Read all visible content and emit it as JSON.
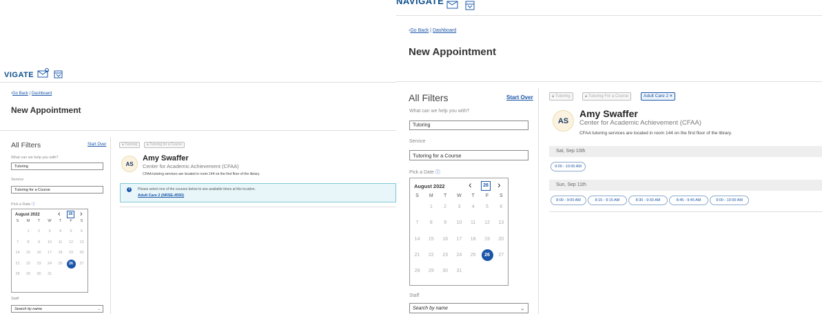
{
  "app": {
    "nav_title": "NAVIGATE",
    "nav_title_left": "VIGATE",
    "breadcrumb": {
      "back": "Go Back",
      "sep": "|",
      "dashboard": "Dashboard"
    },
    "page_title": "New Appointment"
  },
  "filters": {
    "title": "All Filters",
    "start_over": "Start Over",
    "help_label": "What can we help you with?",
    "help_value": "Tutoring",
    "service_label": "Service",
    "service_value": "Tutoring for a Course",
    "date_label": "Pick a Date",
    "staff_label": "Staff",
    "staff_placeholder": "Search by name"
  },
  "calendar": {
    "month": "August 2022",
    "today": "26",
    "selected": "26",
    "dow": [
      "S",
      "M",
      "T",
      "W",
      "T",
      "F",
      "S"
    ],
    "weeks": [
      [
        "",
        "1",
        "2",
        "3",
        "4",
        "5",
        "6"
      ],
      [
        "7",
        "8",
        "9",
        "10",
        "11",
        "12",
        "13"
      ],
      [
        "14",
        "15",
        "16",
        "17",
        "18",
        "19",
        "20"
      ],
      [
        "21",
        "22",
        "23",
        "24",
        "25",
        "26",
        "27"
      ],
      [
        "28",
        "29",
        "30",
        "31",
        "",
        "",
        ""
      ]
    ],
    "prev": "‹",
    "next": "›"
  },
  "tags_left": [
    "Tutoring",
    "Tutoring for a Course"
  ],
  "tags_right": [
    "Tutoring",
    "Tutoring For a Course",
    "Adult Care 2"
  ],
  "tag_remove": "×",
  "provider": {
    "initials": "AS",
    "name": "Amy Swaffer",
    "center": "Center for Academic Achievement (CFAA)",
    "location": "CFAA tutoring services are located in room 144 on the first floor of the library."
  },
  "notice": {
    "text": "Please select one of the courses below to see available times at this location.",
    "course": "Adult Care 2 (NRSE-4550)"
  },
  "availability": [
    {
      "day": "Sat, Sep 10th",
      "slots": [
        "9:00 - 10:00 AM"
      ]
    },
    {
      "day": "Sun, Sep 11th",
      "slots": [
        "8:00 - 9:00 AM",
        "8:15 - 9:15 AM",
        "8:30 - 9:30 AM",
        "8:45 - 9:45 AM",
        "9:00 - 10:00 AM"
      ]
    }
  ],
  "colors": {
    "accent": "#1a56a8",
    "nav": "#0d4f8b",
    "avatar_bg": "#fbf3df"
  },
  "icons": [
    "mail-icon",
    "calendar-icon",
    "info-icon",
    "lock-icon",
    "chevron-down-icon",
    "chevron-left-icon",
    "chevron-right-icon"
  ]
}
